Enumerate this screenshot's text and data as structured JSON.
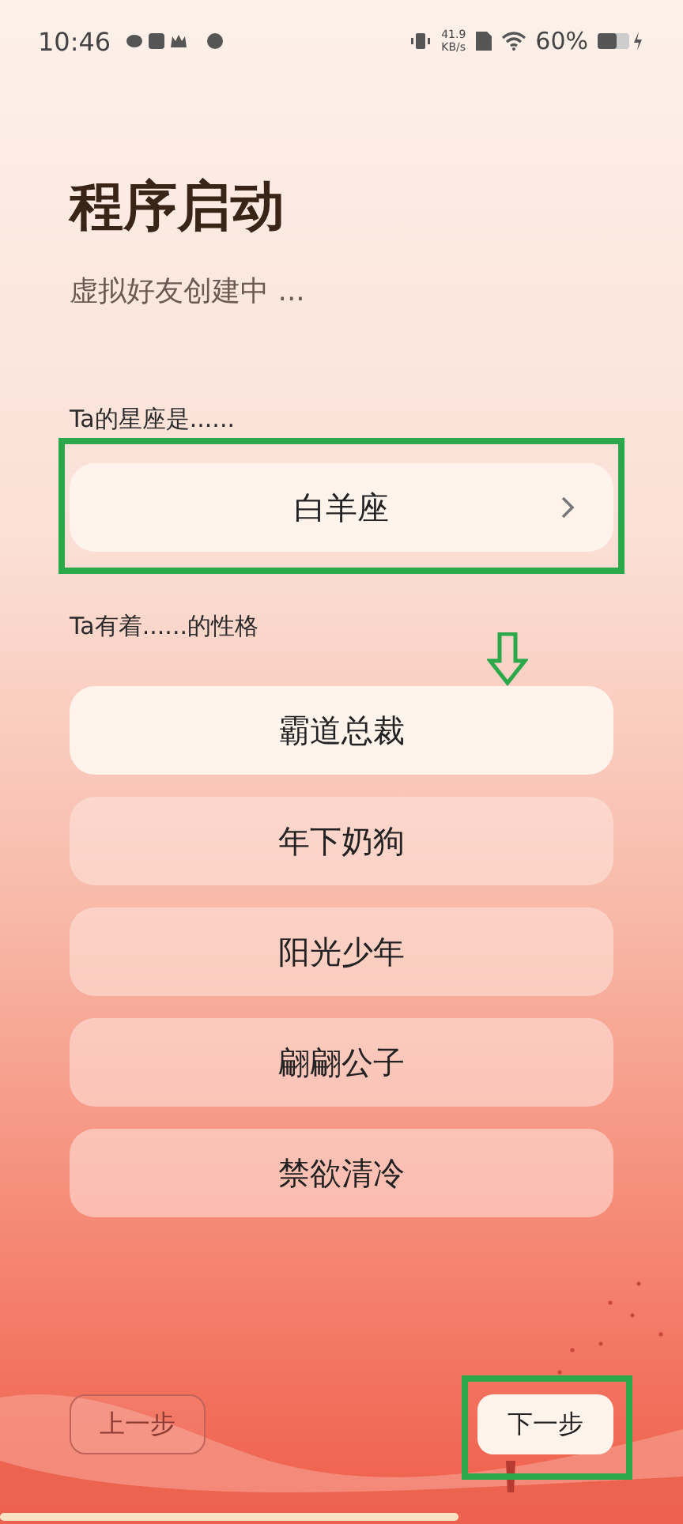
{
  "status_bar": {
    "time": "10:46",
    "net_speed": "41.9",
    "net_unit": "KB/s",
    "battery": "60%"
  },
  "title": "程序启动",
  "subtitle": "虚拟好友创建中 ...",
  "zodiac": {
    "label": "Ta的星座是......",
    "value": "白羊座"
  },
  "personality": {
    "label": "Ta有着......的性格",
    "options": [
      {
        "text": "霸道总裁",
        "selected": true
      },
      {
        "text": "年下奶狗",
        "selected": false
      },
      {
        "text": "阳光少年",
        "selected": false
      },
      {
        "text": "翩翩公子",
        "selected": false
      },
      {
        "text": "禁欲清冷",
        "selected": false
      }
    ]
  },
  "buttons": {
    "prev": {
      "text": "上一步",
      "disabled": true
    },
    "next": {
      "text": "下一步",
      "disabled": false
    }
  }
}
